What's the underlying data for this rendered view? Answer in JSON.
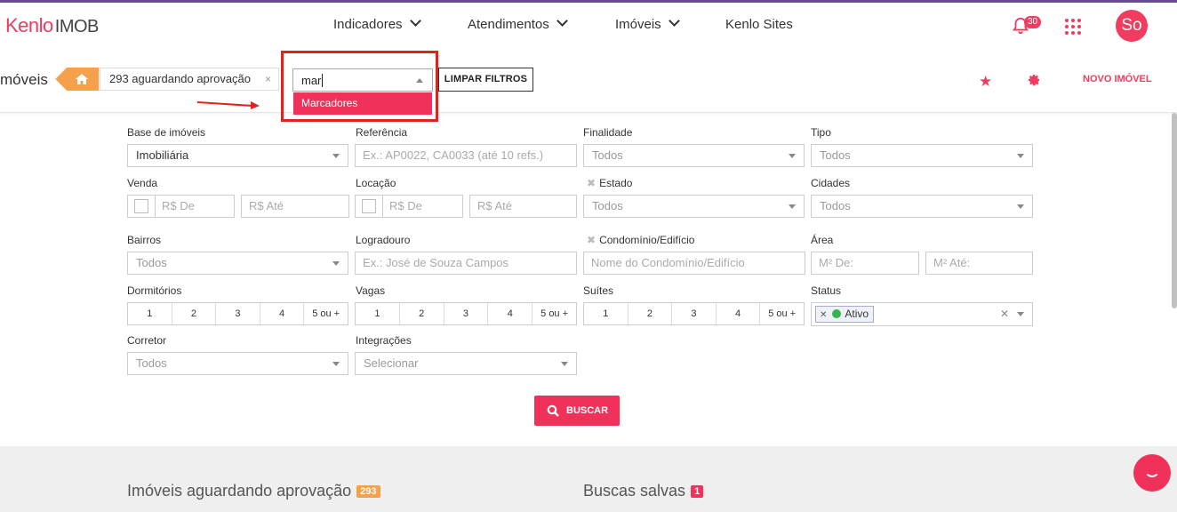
{
  "header": {
    "logo_main": "Kenlo",
    "logo_sub": "IMOB",
    "nav": [
      {
        "label": "Indicadores",
        "has_dropdown": true
      },
      {
        "label": "Atendimentos",
        "has_dropdown": true
      },
      {
        "label": "Imóveis",
        "has_dropdown": true
      },
      {
        "label": "Kenlo Sites",
        "has_dropdown": false
      }
    ],
    "notifications_count": "30",
    "avatar_initials": "So"
  },
  "toolbar": {
    "page_title": "móveis",
    "breadcrumb_filter": "293 aguardando aprovação",
    "breadcrumb_remove": "×",
    "marker_search_value": "mar",
    "marker_option": "Marcadores",
    "clear_filters": "LIMPAR FILTROS",
    "new_property": "NOVO IMÓVEL"
  },
  "filters": {
    "base": {
      "label": "Base de imóveis",
      "value": "Imobiliária"
    },
    "referencia": {
      "label": "Referência",
      "placeholder": "Ex.: AP0022, CA0033 (até 10 refs.)"
    },
    "finalidade": {
      "label": "Finalidade",
      "value": "Todos"
    },
    "tipo": {
      "label": "Tipo",
      "value": "Todos"
    },
    "venda": {
      "label": "Venda",
      "de": "R$ De",
      "ate": "R$ Até"
    },
    "locacao": {
      "label": "Locação",
      "de": "R$ De",
      "ate": "R$ Até"
    },
    "estado": {
      "label": "Estado",
      "value": "Todos"
    },
    "cidades": {
      "label": "Cidades",
      "value": "Todos"
    },
    "bairros": {
      "label": "Bairros",
      "value": "Todos"
    },
    "logradouro": {
      "label": "Logradouro",
      "placeholder": "Ex.: José de Souza Campos"
    },
    "condominio": {
      "label": "Condomínio/Edifício",
      "placeholder": "Nome do Condomínio/Edifício"
    },
    "area": {
      "label": "Área",
      "de": "M² De:",
      "ate": "M² Até:"
    },
    "dormitorios": {
      "label": "Dormitórios",
      "options": [
        "1",
        "2",
        "3",
        "4",
        "5 ou +"
      ]
    },
    "vagas": {
      "label": "Vagas",
      "options": [
        "1",
        "2",
        "3",
        "4",
        "5 ou +"
      ]
    },
    "suites": {
      "label": "Suítes",
      "options": [
        "1",
        "2",
        "3",
        "4",
        "5 ou +"
      ]
    },
    "status": {
      "label": "Status",
      "tag": "Ativo",
      "tag_color": "#35b44a"
    },
    "corretor": {
      "label": "Corretor",
      "value": "Todos"
    },
    "integracoes": {
      "label": "Integrações",
      "value": "Selecionar"
    },
    "search_button": "BUSCAR"
  },
  "bottom": {
    "awaiting_title": "Imóveis aguardando aprovação",
    "awaiting_count": "293",
    "saved_title": "Buscas salvas",
    "saved_count": "1"
  },
  "colors": {
    "brand": "#f03c5f",
    "accent_orange": "#f5a04b",
    "highlight_box": "#e2231a"
  }
}
